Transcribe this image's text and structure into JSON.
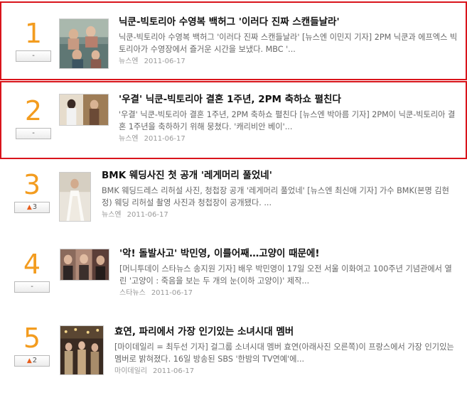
{
  "colors": {
    "rank_orange": "#f39c1f",
    "highlight_border": "#d9141b",
    "title_text": "#111111",
    "summary_text": "#666666",
    "meta_text": "#999999",
    "rank_up_arrow": "#e85d1a"
  },
  "items": [
    {
      "rank": "1",
      "change": "-",
      "change_icon": "",
      "title": "닉쿤-빅토리아 수영복 백허그 '이러다 진짜 스캔들날라'",
      "summary": "닉쿤-빅토리아 수영복 백허그 '이러다 진짜 스캔들날라' [뉴스엔 이민지 기자] 2PM 닉쿤과 에프엑스 빅토리아가 수영장에서 즐거운 시간을 보냈다. MBC '...",
      "source": "뉴스엔",
      "date": "2011-06-17"
    },
    {
      "rank": "2",
      "change": "-",
      "change_icon": "",
      "title": "'우결' 닉쿤-빅토리아 결혼 1주년, 2PM 축하쇼 펼친다",
      "summary": "'우결' 닉쿤-빅토리아 결혼 1주년, 2PM 축하쇼 펼친다 [뉴스엔 박아름 기자] 2PM이 닉쿤-빅토리아 결혼 1주년을 축하하기 위해 뭉쳤다. '캐리비안 베이'...",
      "source": "뉴스엔",
      "date": "2011-06-17"
    },
    {
      "rank": "3",
      "change": "3",
      "change_icon": "up-arrow-icon",
      "title": "BMK 웨딩사진 첫 공개 '레게머리 풀었네'",
      "summary": "BMK 웨딩드레스 리허설 사진, 청첩장 공개 '레게머리 풀었네' [뉴스엔 최신애 기자] 가수 BMK(본명 김현정) 웨딩 리허설 촬영 사진과 청첩장이 공개됐다. ...",
      "source": "뉴스엔",
      "date": "2011-06-17"
    },
    {
      "rank": "4",
      "change": "-",
      "change_icon": "",
      "title": "'악! 돌발사고' 박민영, 이를어째…고양이 때문에!",
      "summary": "[머니투데이 스타뉴스 송지원 기자] 배우 박민영이 17일 오전 서울 이화여고 100주년 기념관에서 열린 '고양이 : 죽음을 보는 두 개의 눈(이하 고양이)' 제작...",
      "source": "스타뉴스",
      "date": "2011-06-17"
    },
    {
      "rank": "5",
      "change": "2",
      "change_icon": "up-arrow-icon",
      "title": "효연, 파리에서 가장 인기있는 소녀시대 멤버",
      "summary": "[마이데일리 = 최두선 기자] 걸그룹 소녀시대 멤버 효연(아래사진 오른쪽)이 프랑스에서 가장 인기있는 멤버로 밝혀졌다. 16일 방송된 SBS '한밤의 TV연예'에...",
      "source": "마이데일리",
      "date": "2011-06-17"
    }
  ]
}
